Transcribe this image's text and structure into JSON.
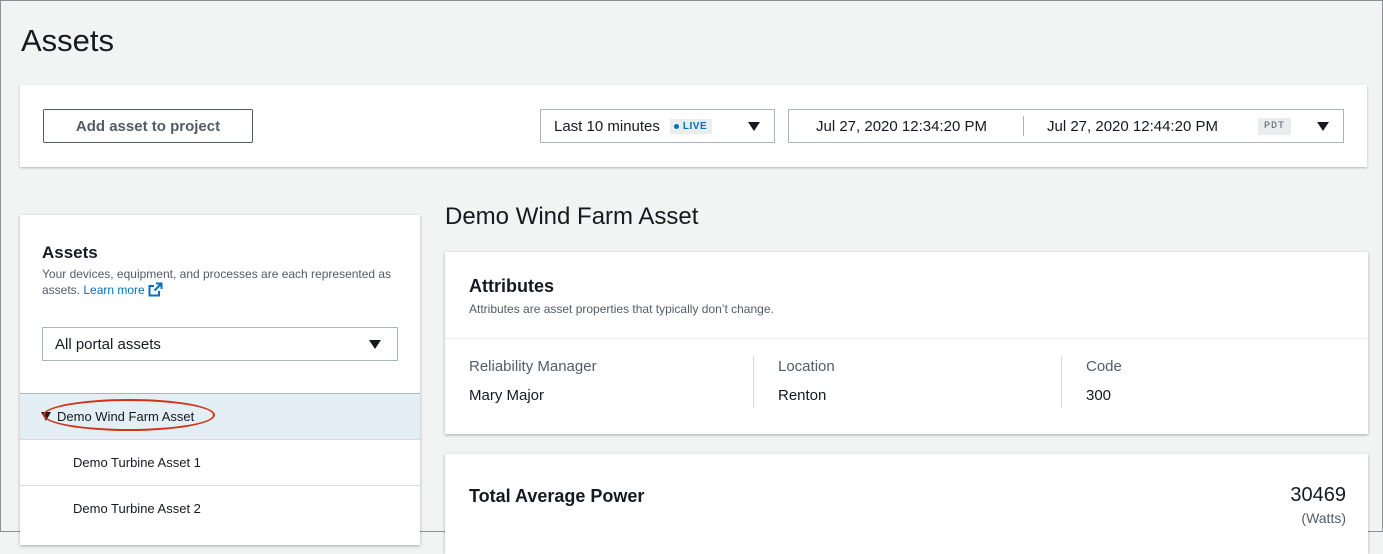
{
  "page": {
    "title": "Assets"
  },
  "toolbar": {
    "add_button_label": "Add asset to project",
    "range": {
      "label": "Last 10 minutes",
      "live_badge": "LIVE"
    },
    "datetime": {
      "start": "Jul 27, 2020 12:34:20 PM",
      "end": "Jul 27, 2020 12:44:20 PM",
      "timezone": "PDT"
    }
  },
  "assets_panel": {
    "title": "Assets",
    "description": "Your devices, equipment, and processes are each represented as assets.",
    "learn_more": "Learn more",
    "filter": {
      "selected": "All portal assets"
    },
    "tree": {
      "root": {
        "label": "Demo Wind Farm Asset",
        "expanded": true,
        "selected": true
      },
      "children": [
        {
          "label": "Demo Turbine Asset 1"
        },
        {
          "label": "Demo Turbine Asset 2"
        }
      ]
    }
  },
  "asset_detail": {
    "heading": "Demo Wind Farm Asset",
    "attributes": {
      "title": "Attributes",
      "description": "Attributes are asset properties that typically don’t change.",
      "items": [
        {
          "label": "Reliability Manager",
          "value": "Mary Major"
        },
        {
          "label": "Location",
          "value": "Renton"
        },
        {
          "label": "Code",
          "value": "300"
        }
      ]
    },
    "metric": {
      "title": "Total Average Power",
      "value": "30469",
      "unit": "(Watts)"
    }
  },
  "colors": {
    "link": "#0073bb",
    "highlight_ring": "#d13212",
    "selected_row": "#e3eef5",
    "page_bg": "#f2f3f3"
  },
  "icons": [
    "external-link-icon",
    "caret-down-icon",
    "tree-expand-icon",
    "live-dot-icon"
  ]
}
